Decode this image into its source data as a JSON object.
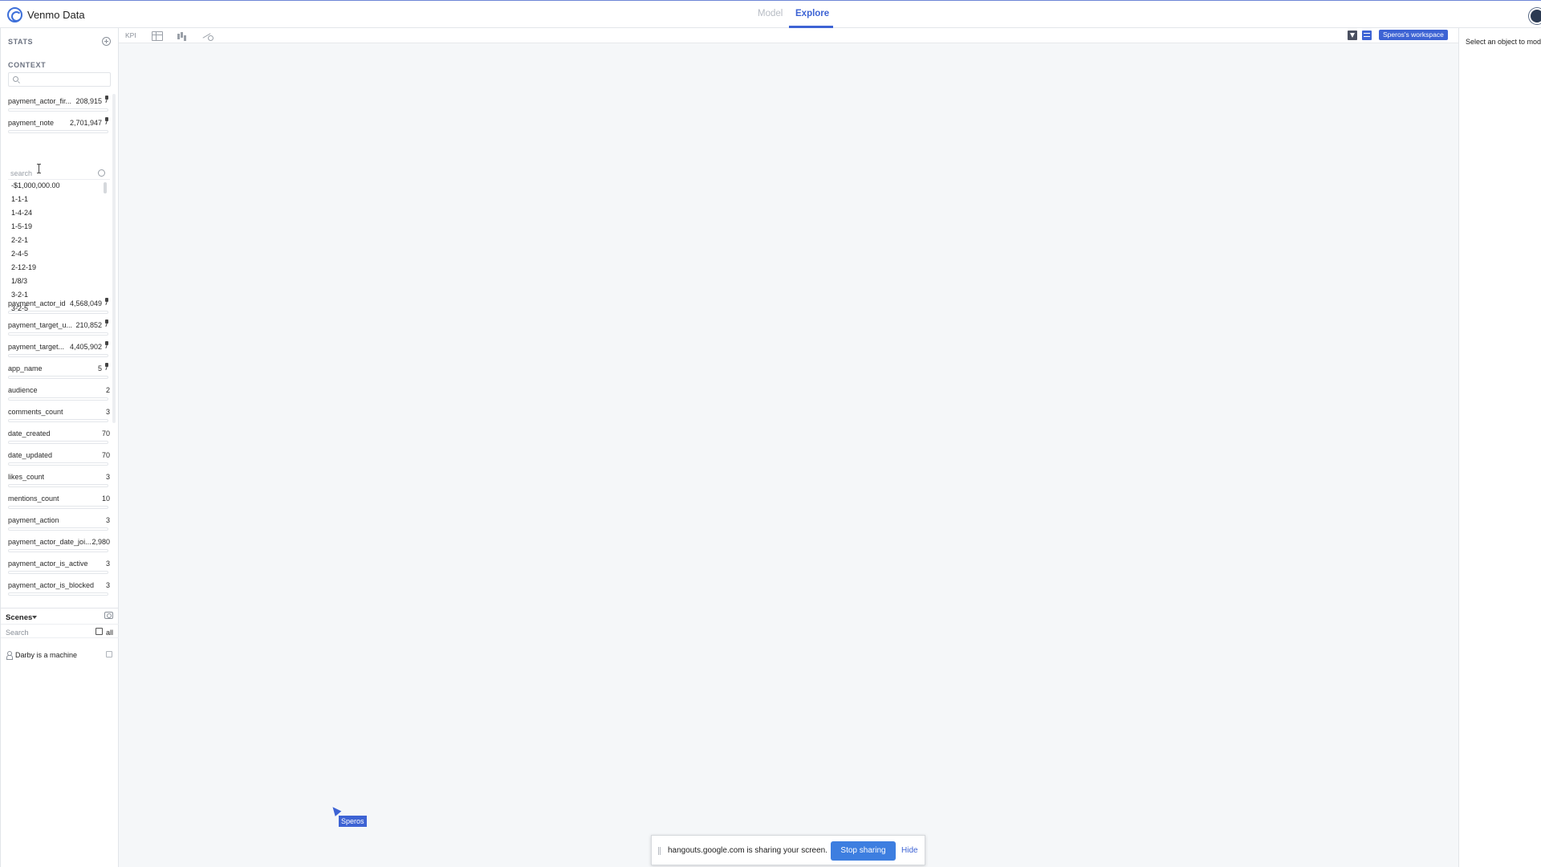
{
  "header": {
    "app_title": "Venmo Data",
    "tabs": [
      {
        "label": "Model",
        "active": false
      },
      {
        "label": "Explore",
        "active": true
      }
    ]
  },
  "left_panel": {
    "stats_label": "STATS",
    "context_label": "CONTEXT",
    "stats": [
      {
        "name": "payment_actor_fir...",
        "count": "208,915",
        "pinned": true
      },
      {
        "name": "payment_note",
        "count": "2,701,947",
        "pinned": true
      },
      {
        "name": "payment_actor_id",
        "count": "4,568,049",
        "pinned": true
      },
      {
        "name": "payment_target_u...",
        "count": "210,852",
        "pinned": true
      },
      {
        "name": "payment_target...",
        "count": "4,405,902",
        "pinned": true
      },
      {
        "name": "app_name",
        "count": "5",
        "pinned": true
      },
      {
        "name": "audience",
        "count": "2",
        "pinned": false
      },
      {
        "name": "comments_count",
        "count": "3",
        "pinned": false
      },
      {
        "name": "date_created",
        "count": "70",
        "pinned": false
      },
      {
        "name": "date_updated",
        "count": "70",
        "pinned": false
      },
      {
        "name": "likes_count",
        "count": "3",
        "pinned": false
      },
      {
        "name": "mentions_count",
        "count": "10",
        "pinned": false
      },
      {
        "name": "payment_action",
        "count": "3",
        "pinned": false
      },
      {
        "name": "payment_actor_date_joi...",
        "count": "2,980",
        "pinned": false
      },
      {
        "name": "payment_actor_is_active",
        "count": "3",
        "pinned": false
      },
      {
        "name": "payment_actor_is_blocked",
        "count": "3",
        "pinned": false
      }
    ],
    "value_search_placeholder": "search",
    "values": [
      "-$1,000,000.00",
      "1-1-1",
      "1-4-24",
      "1-5-19",
      "2-2-1",
      "2-4-5",
      "2-12-19",
      "1/8/3",
      "3-2-1",
      "3-2-5"
    ]
  },
  "scenes": {
    "label": "Scenes",
    "search_placeholder": "Search",
    "all_label": "all",
    "items": [
      {
        "name": "Darby is a machine"
      }
    ]
  },
  "toolbar": {
    "kpi_label": "KPI",
    "workspace_label": "Speros's workspace"
  },
  "canvas": {
    "cursor_user": "Speros"
  },
  "right_panel": {
    "hint": "Select an object to modify its properties"
  },
  "share_bar": {
    "message": "hangouts.google.com is sharing your screen.",
    "stop_label": "Stop sharing",
    "hide_label": "Hide"
  },
  "colors": {
    "accent": "#3d63d4",
    "share_button": "#3d7ee0",
    "canvas_bg": "#f5f7f9"
  }
}
